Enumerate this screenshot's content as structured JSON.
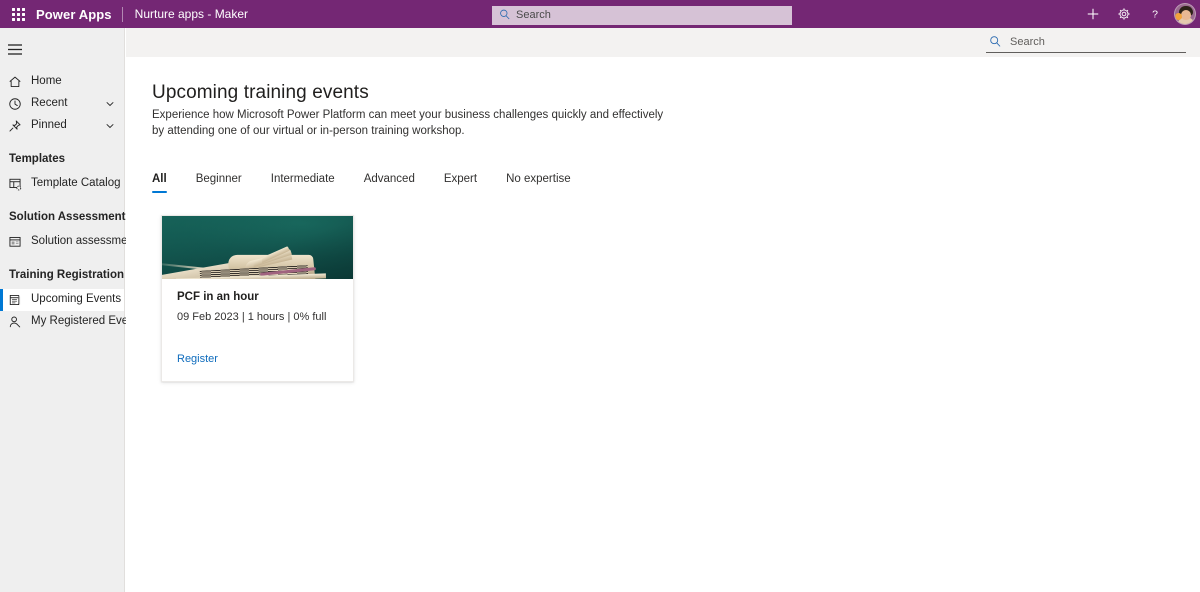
{
  "suite_bar": {
    "waffle_label": "App launcher",
    "brand": "Power Apps",
    "environment": "Nurture apps - Maker",
    "search_placeholder": "Search",
    "search_value": "",
    "actions": [
      {
        "name": "new-button",
        "glyph": "+"
      },
      {
        "name": "settings-button",
        "glyph": "gear"
      },
      {
        "name": "help-button",
        "glyph": "?"
      }
    ]
  },
  "command_bar": {
    "search_placeholder": "Search",
    "search_value": ""
  },
  "sidebar": {
    "nav": [
      {
        "label": "Home",
        "icon": "home-icon",
        "chevron": false,
        "selected": false
      },
      {
        "label": "Recent",
        "icon": "clock-icon",
        "chevron": true,
        "selected": false
      },
      {
        "label": "Pinned",
        "icon": "pin-icon",
        "chevron": true,
        "selected": false
      }
    ],
    "groups": [
      {
        "title": "Templates",
        "items": [
          {
            "label": "Template Catalog",
            "icon": "template-catalog-icon",
            "selected": false
          }
        ]
      },
      {
        "title": "Solution Assessment",
        "items": [
          {
            "label": "Solution assessment",
            "icon": "solution-assessment-icon",
            "selected": false
          }
        ]
      },
      {
        "title": "Training Registration",
        "items": [
          {
            "label": "Upcoming Events",
            "icon": "calendar-events-icon",
            "selected": true
          },
          {
            "label": "My Registered Events",
            "icon": "person-icon",
            "selected": false
          }
        ]
      }
    ]
  },
  "main": {
    "title": "Upcoming training events",
    "description": "Experience how Microsoft Power Platform can meet your business challenges quickly and effectively by attending one of our virtual or in-person training workshop.",
    "tabs": [
      {
        "label": "All",
        "active": true
      },
      {
        "label": "Beginner",
        "active": false
      },
      {
        "label": "Intermediate",
        "active": false
      },
      {
        "label": "Advanced",
        "active": false
      },
      {
        "label": "Expert",
        "active": false
      },
      {
        "label": "No expertise",
        "active": false
      }
    ],
    "cards": [
      {
        "title": "PCF in an hour",
        "meta": "09 Feb 2023 | 1 hours | 0% full",
        "link_label": "Register",
        "image_alt": "open book on dark teal background"
      }
    ]
  },
  "colors": {
    "suite_bar": "#742774",
    "sidebar_bg": "#efefef",
    "command_bar_bg": "#f3f2f1",
    "accent_blue": "#0078d4",
    "link_blue": "#0f6cbd",
    "card_image_bg": "#0f4f4a"
  }
}
